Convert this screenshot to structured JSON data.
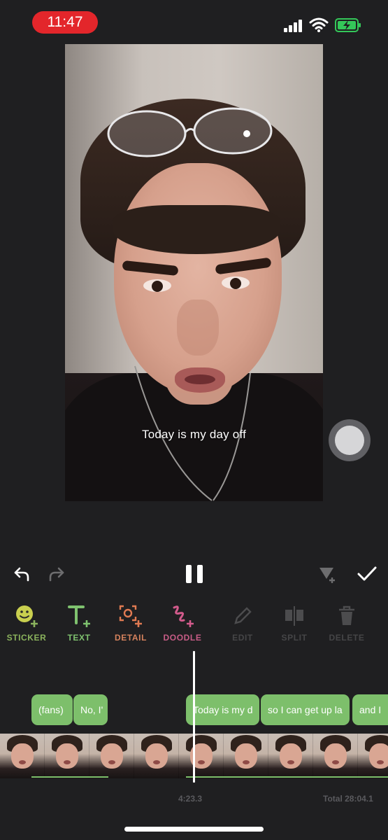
{
  "status_bar": {
    "time": "11:47"
  },
  "video": {
    "subtitle": "Today is my day off"
  },
  "toolbar": {
    "sticker": "STICKER",
    "text": "TEXT",
    "detail": "DETAIL",
    "doodle": "DOODLE",
    "edit": "EDIT",
    "split": "SPLIT",
    "delete": "DELETE"
  },
  "timeline": {
    "clips": [
      "(fans)",
      "No, I'",
      "Today is my d",
      "so I can get up la",
      "and I"
    ],
    "current_time": "4:23.3",
    "total_time": "Total 28:04.1"
  },
  "colors": {
    "accent_green": "#7dbf6b",
    "time_pill": "#e3262b",
    "background": "#1f1f21"
  }
}
